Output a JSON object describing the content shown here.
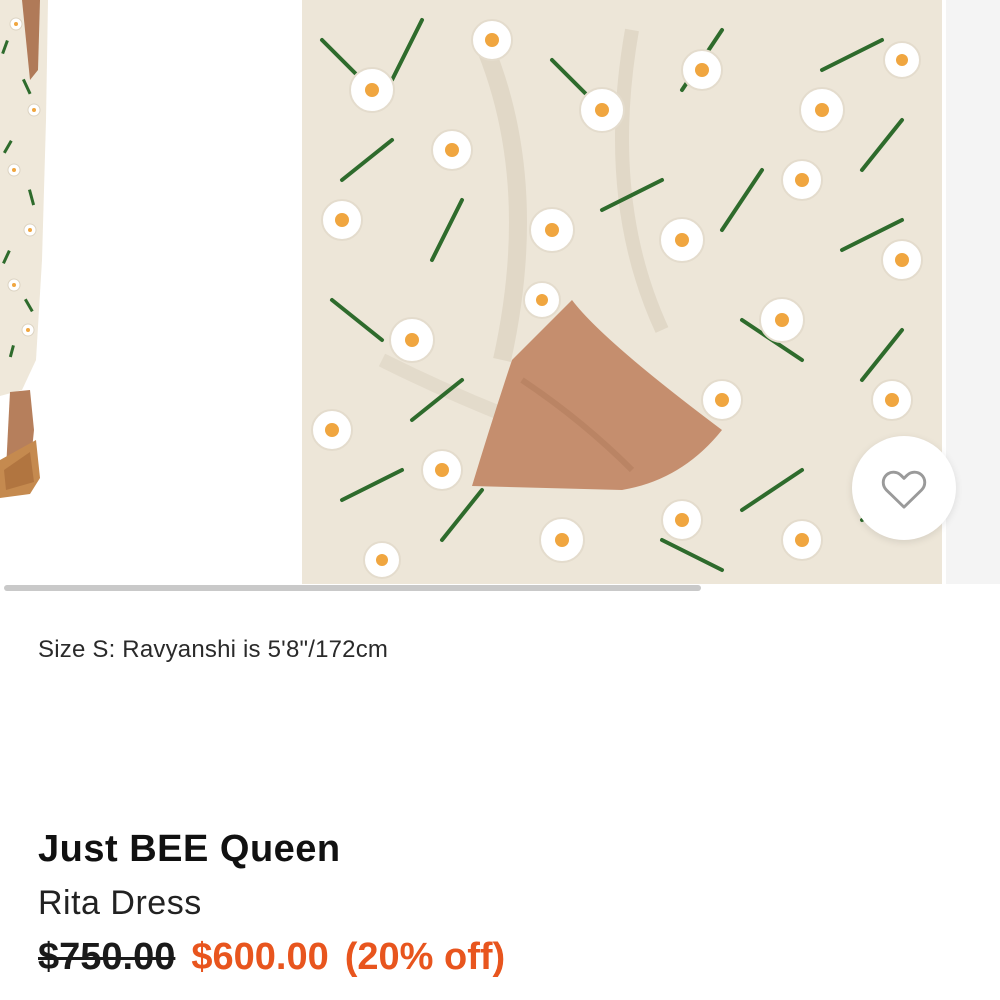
{
  "product": {
    "model_caption": "Size S: Ravyanshi is 5'8\"/172cm",
    "brand": "Just BEE Queen",
    "name": "Rita Dress",
    "price_original": "$750.00",
    "price_sale": "$600.00",
    "discount_label": "(20% off)"
  },
  "gallery": {
    "images": [
      {
        "icon": "model-legs-floral-dress-photo"
      },
      {
        "icon": "floral-dress-cutout-closeup-photo"
      },
      {
        "icon": "next-image-peek"
      }
    ],
    "scroll_progress": 0.7
  },
  "favorite": {
    "icon": "heart-outline-icon",
    "selected": false
  },
  "colors": {
    "sale_price": "#e8551e",
    "fabric": "#ede6d8",
    "leaf": "#2e6b2c",
    "flower_center": "#f0a640"
  }
}
